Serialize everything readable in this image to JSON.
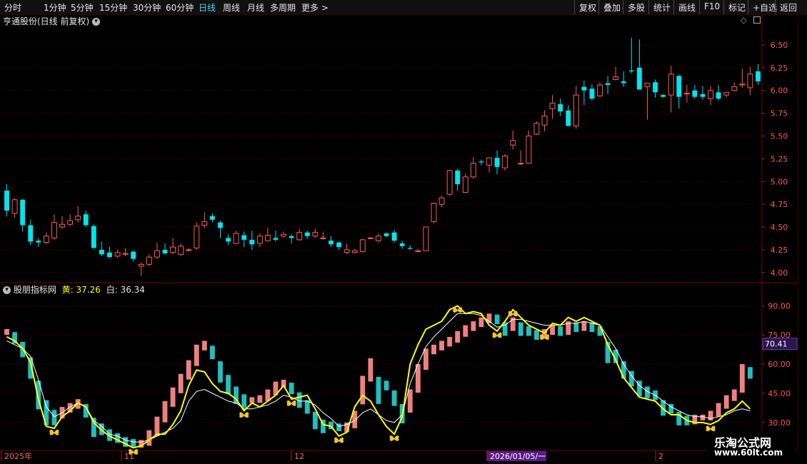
{
  "toolbar": {
    "periods": [
      "分时",
      "1分钟",
      "5分钟",
      "15分钟",
      "30分钟",
      "60分钟",
      "日线",
      "周线",
      "月线",
      "多周期",
      "更多 >"
    ],
    "active": "日线",
    "actions": [
      "复权",
      "叠加",
      "多股",
      "统计",
      "画线",
      "F10",
      "标记",
      "+自选",
      "返回"
    ]
  },
  "main": {
    "title": "亨通股份(日线 前复权)",
    "y_ticks": [
      "6.50",
      "6.25",
      "6.00",
      "5.75",
      "5.50",
      "5.25",
      "5.00",
      "4.75",
      "4.50",
      "4.25",
      "4.00"
    ]
  },
  "indicator": {
    "name": "股朋指标网",
    "yellow_label": "黄: 37.26",
    "white_label": "白: 36.34",
    "y_ticks": [
      "90.00",
      "75.00",
      "60.00",
      "45.00",
      "30.00"
    ],
    "current_badge": "70.41"
  },
  "x_axis": {
    "labels": [
      "2025年",
      "11",
      "12",
      "2026/01/05/一",
      "2"
    ]
  },
  "watermark": {
    "name": "乐淘公式网",
    "url": "www.60lt.com"
  },
  "colors": {
    "up": "#ff5a5a",
    "down": "#00e5ee",
    "yellow_line": "#ffff00",
    "white_line": "#ffffff",
    "grid": "#5a0000",
    "hist_up": "#f08080",
    "hist_down": "#1fbfbf",
    "butterfly": "#f4c430"
  },
  "chart_data": [
    {
      "type": "candlestick",
      "title": "亨通股份(日线 前复权)",
      "ylim": [
        3.92,
        6.68
      ],
      "ohlc": [
        [
          4.9,
          4.97,
          4.62,
          4.68
        ],
        [
          4.65,
          4.82,
          4.6,
          4.8
        ],
        [
          4.8,
          4.81,
          4.45,
          4.52
        ],
        [
          4.52,
          4.58,
          4.3,
          4.34
        ],
        [
          4.35,
          4.38,
          4.28,
          4.33
        ],
        [
          4.33,
          4.44,
          4.31,
          4.4
        ],
        [
          4.38,
          4.64,
          4.36,
          4.55
        ],
        [
          4.5,
          4.62,
          4.48,
          4.53
        ],
        [
          4.53,
          4.64,
          4.51,
          4.57
        ],
        [
          4.58,
          4.73,
          4.55,
          4.62
        ],
        [
          4.64,
          4.68,
          4.5,
          4.52
        ],
        [
          4.51,
          4.53,
          4.26,
          4.27
        ],
        [
          4.25,
          4.34,
          4.18,
          4.2
        ],
        [
          4.22,
          4.28,
          4.16,
          4.17
        ],
        [
          4.18,
          4.25,
          4.16,
          4.22
        ],
        [
          4.2,
          4.27,
          4.18,
          4.21
        ],
        [
          4.23,
          4.24,
          4.12,
          4.15
        ],
        [
          4.07,
          4.11,
          3.96,
          4.09
        ],
        [
          4.09,
          4.2,
          4.07,
          4.17
        ],
        [
          4.17,
          4.33,
          4.15,
          4.24
        ],
        [
          4.25,
          4.32,
          4.2,
          4.21
        ],
        [
          4.22,
          4.38,
          4.2,
          4.28
        ],
        [
          4.2,
          4.32,
          4.18,
          4.29
        ],
        [
          4.25,
          4.27,
          4.23,
          4.25
        ],
        [
          4.27,
          4.55,
          4.25,
          4.51
        ],
        [
          4.52,
          4.66,
          4.49,
          4.56
        ],
        [
          4.62,
          4.65,
          4.55,
          4.58
        ],
        [
          4.55,
          4.57,
          4.38,
          4.49
        ],
        [
          4.38,
          4.42,
          4.3,
          4.34
        ],
        [
          4.32,
          4.46,
          4.31,
          4.43
        ],
        [
          4.41,
          4.45,
          4.28,
          4.36
        ],
        [
          4.36,
          4.46,
          4.25,
          4.31
        ],
        [
          4.32,
          4.43,
          4.28,
          4.4
        ],
        [
          4.35,
          4.49,
          4.34,
          4.41
        ],
        [
          4.38,
          4.46,
          4.34,
          4.36
        ],
        [
          4.4,
          4.45,
          4.38,
          4.42
        ],
        [
          4.4,
          4.42,
          4.32,
          4.38
        ],
        [
          4.36,
          4.48,
          4.35,
          4.44
        ],
        [
          4.44,
          4.46,
          4.37,
          4.4
        ],
        [
          4.4,
          4.48,
          4.38,
          4.44
        ],
        [
          4.38,
          4.45,
          4.36,
          4.38
        ],
        [
          4.35,
          4.4,
          4.28,
          4.31
        ],
        [
          4.33,
          4.34,
          4.25,
          4.28
        ],
        [
          4.22,
          4.32,
          4.2,
          4.25
        ],
        [
          4.22,
          4.26,
          4.21,
          4.24
        ],
        [
          4.23,
          4.37,
          4.22,
          4.36
        ],
        [
          4.38,
          4.39,
          4.37,
          4.38
        ],
        [
          4.35,
          4.43,
          4.33,
          4.4
        ],
        [
          4.43,
          4.44,
          4.39,
          4.4
        ],
        [
          4.44,
          4.47,
          4.33,
          4.35
        ],
        [
          4.32,
          4.35,
          4.26,
          4.29
        ],
        [
          4.27,
          4.3,
          4.25,
          4.26
        ],
        [
          4.23,
          4.26,
          4.22,
          4.24
        ],
        [
          4.24,
          4.47,
          4.24,
          4.5
        ],
        [
          4.56,
          4.77,
          4.54,
          4.76
        ],
        [
          4.75,
          4.84,
          4.72,
          4.82
        ],
        [
          4.86,
          5.13,
          4.84,
          5.12
        ],
        [
          5.12,
          5.14,
          4.9,
          4.97
        ],
        [
          4.88,
          5.09,
          4.87,
          5.05
        ],
        [
          5.05,
          5.27,
          5.03,
          5.2
        ],
        [
          5.22,
          5.24,
          5.18,
          5.21
        ],
        [
          5.18,
          5.26,
          5.1,
          5.26
        ],
        [
          5.26,
          5.34,
          5.08,
          5.16
        ],
        [
          5.15,
          5.3,
          5.12,
          5.28
        ],
        [
          5.4,
          5.56,
          5.35,
          5.45
        ],
        [
          5.2,
          5.34,
          5.18,
          5.2
        ],
        [
          5.2,
          5.56,
          5.2,
          5.5
        ],
        [
          5.52,
          5.66,
          5.51,
          5.64
        ],
        [
          5.62,
          5.78,
          5.55,
          5.72
        ],
        [
          5.8,
          5.95,
          5.69,
          5.86
        ],
        [
          5.85,
          5.91,
          5.72,
          5.77
        ],
        [
          5.78,
          5.84,
          5.62,
          5.61
        ],
        [
          5.61,
          6.05,
          5.58,
          5.95
        ],
        [
          6.04,
          6.11,
          5.84,
          6.0
        ],
        [
          6.02,
          6.07,
          5.89,
          5.91
        ],
        [
          5.94,
          6.09,
          5.93,
          6.06
        ],
        [
          6.08,
          6.16,
          5.96,
          6.06
        ],
        [
          6.12,
          6.26,
          6.11,
          6.15
        ],
        [
          6.1,
          6.21,
          6.04,
          6.08
        ],
        [
          6.22,
          6.58,
          6.19,
          6.21
        ],
        [
          6.25,
          6.56,
          6.03,
          6.01
        ],
        [
          6.04,
          6.08,
          5.68,
          6.08
        ],
        [
          6.09,
          6.12,
          5.92,
          5.98
        ],
        [
          5.95,
          5.96,
          5.92,
          5.93
        ],
        [
          5.95,
          6.27,
          5.76,
          6.18
        ],
        [
          6.16,
          6.17,
          5.8,
          5.93
        ],
        [
          5.96,
          6.06,
          5.87,
          5.97
        ],
        [
          6.0,
          6.06,
          5.91,
          5.93
        ],
        [
          5.96,
          6.05,
          5.9,
          5.93
        ],
        [
          5.91,
          6.05,
          5.84,
          6.0
        ],
        [
          5.98,
          6.06,
          5.89,
          5.91
        ],
        [
          5.95,
          5.97,
          5.92,
          5.98
        ],
        [
          6.0,
          6.09,
          5.99,
          6.04
        ],
        [
          6.06,
          6.24,
          6.03,
          6.07
        ],
        [
          6.03,
          6.26,
          5.95,
          6.18
        ],
        [
          6.21,
          6.29,
          6.06,
          6.1
        ]
      ]
    },
    {
      "type": "indicator",
      "title": "股朋指标网",
      "ylim": [
        16,
        96
      ],
      "series": [
        {
          "name": "黄",
          "values": [
            74,
            72,
            68,
            61,
            42,
            28,
            27,
            33,
            36,
            40,
            38,
            30,
            26,
            23,
            21,
            19,
            17,
            18,
            21,
            24,
            24,
            29,
            36,
            49,
            57,
            56,
            50,
            46,
            45,
            42,
            36,
            40,
            38,
            41,
            44,
            49,
            42,
            43,
            44,
            37,
            29,
            28,
            23,
            25,
            38,
            44,
            41,
            34,
            28,
            24,
            33,
            60,
            70,
            78,
            80,
            82,
            88,
            90,
            86,
            87,
            86,
            80,
            77,
            82,
            88,
            84,
            80,
            78,
            76,
            81,
            80,
            84,
            82,
            84,
            82,
            80,
            70,
            62,
            53,
            48,
            43,
            42,
            41,
            37,
            34,
            34,
            31,
            30,
            30,
            29,
            31,
            35,
            37,
            41,
            37
          ]
        },
        {
          "name": "白",
          "values": [
            72,
            70,
            68,
            64,
            52,
            38,
            33,
            35,
            38,
            40,
            38,
            31,
            28,
            24,
            23,
            21,
            20,
            20,
            21,
            23,
            25,
            27,
            31,
            41,
            46,
            47,
            45,
            43,
            41,
            40,
            37,
            37,
            38,
            39,
            41,
            44,
            43,
            41,
            41,
            39,
            35,
            32,
            28,
            29,
            31,
            35,
            37,
            34,
            31,
            30,
            34,
            50,
            60,
            69,
            74,
            78,
            82,
            86,
            86,
            86,
            85,
            82,
            79,
            80,
            83,
            83,
            82,
            81,
            80,
            80,
            80,
            81,
            81,
            82,
            81,
            80,
            74,
            68,
            60,
            54,
            49,
            46,
            44,
            41,
            38,
            36,
            34,
            33,
            33,
            32,
            33,
            34,
            36,
            37,
            36
          ]
        }
      ],
      "histogram": [
        78,
        75,
        70,
        62,
        50,
        40,
        35,
        38,
        40,
        42,
        38,
        31,
        28,
        25,
        23,
        21,
        20,
        21,
        26,
        33,
        41,
        48,
        55,
        62,
        70,
        72,
        68,
        60,
        53,
        47,
        43,
        43,
        44,
        47,
        51,
        52,
        49,
        44,
        40,
        34,
        30,
        29,
        28,
        30,
        36,
        54,
        63,
        52,
        50,
        45,
        38,
        47,
        60,
        68,
        70,
        72,
        74,
        77,
        80,
        82,
        84,
        86,
        84,
        80,
        84,
        80,
        78,
        76,
        78,
        80,
        78,
        82,
        80,
        82,
        80,
        78,
        70,
        66,
        60,
        55,
        50,
        47,
        45,
        40,
        38,
        34,
        32,
        34,
        34,
        36,
        40,
        44,
        47,
        60,
        57
      ]
    }
  ]
}
